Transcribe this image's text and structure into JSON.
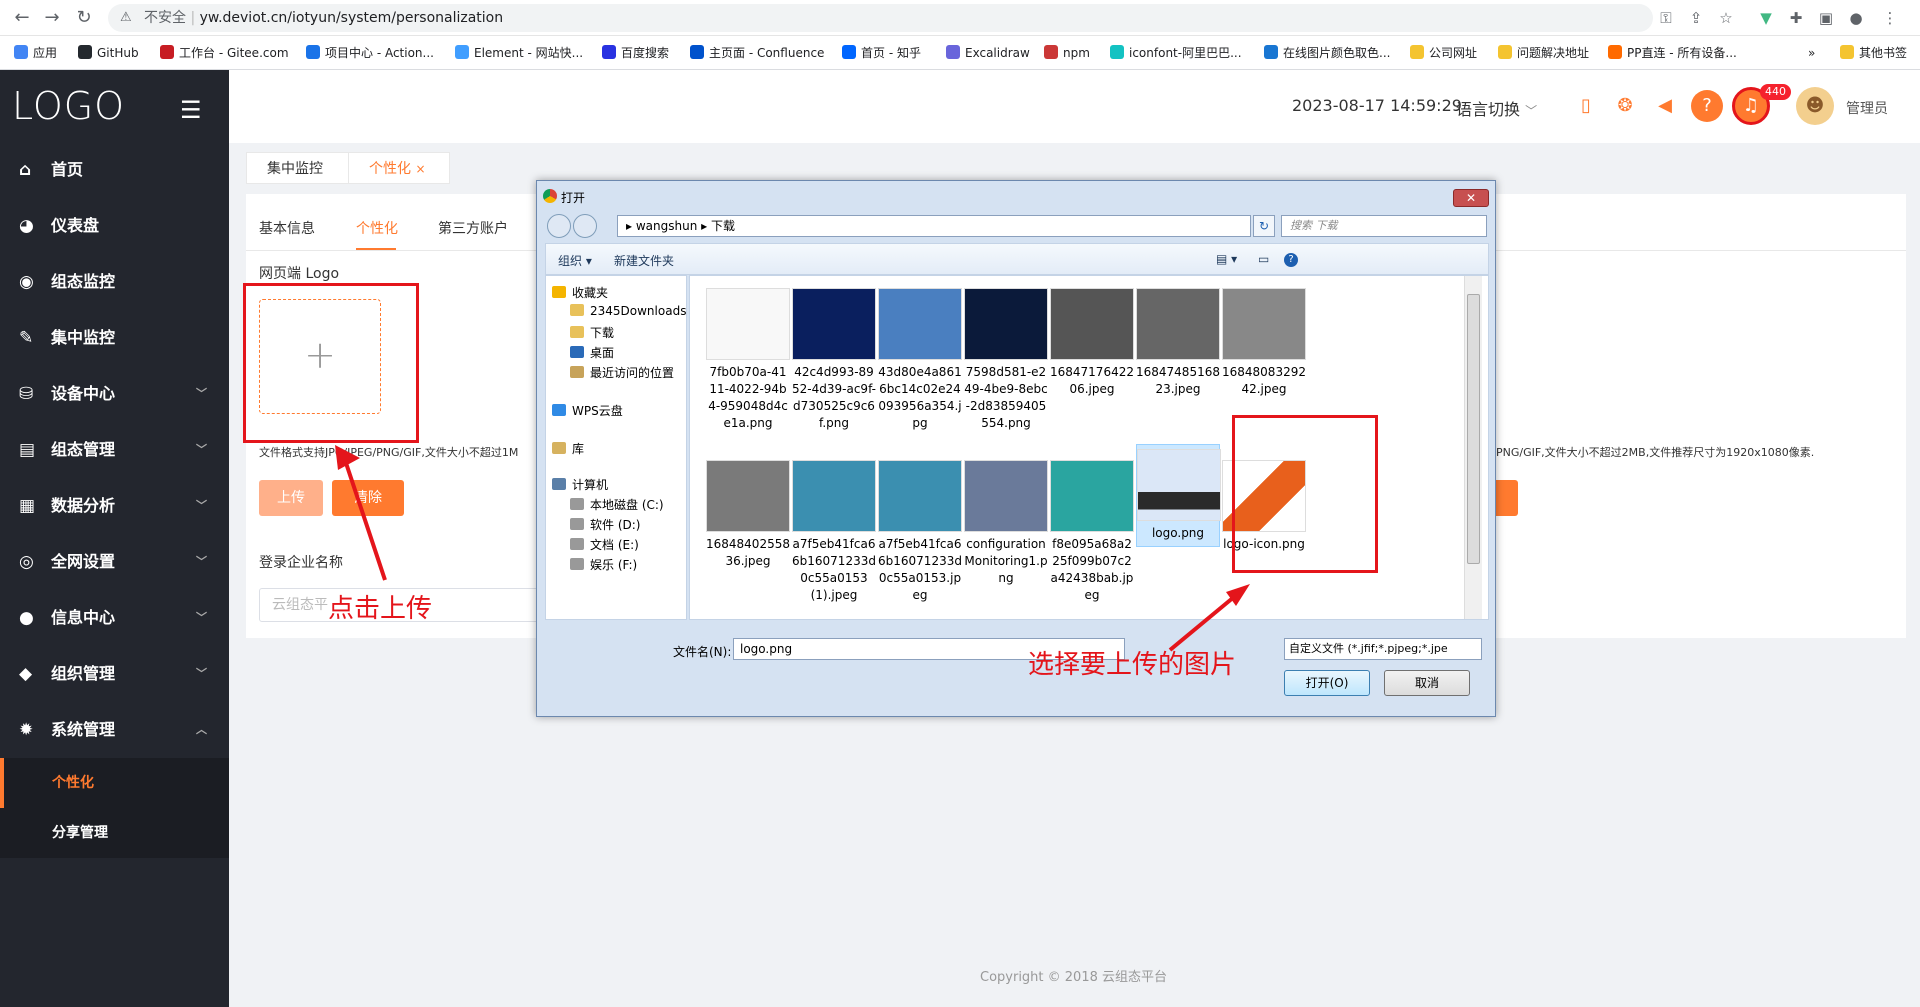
{
  "browser": {
    "insecure_label": "不安全",
    "url": "yw.deviot.cn/iotyun/system/personalization"
  },
  "bookmarks": [
    {
      "label": "应用",
      "color": "#4285f4"
    },
    {
      "label": "GitHub",
      "color": "#24292e"
    },
    {
      "label": "工作台 - Gitee.com",
      "color": "#c71d23"
    },
    {
      "label": "项目中心 - Action...",
      "color": "#1a73e8"
    },
    {
      "label": "Element - 网站快...",
      "color": "#409eff"
    },
    {
      "label": "百度搜索",
      "color": "#2932e1"
    },
    {
      "label": "主页面 - Confluence",
      "color": "#0052cc"
    },
    {
      "label": "首页 - 知乎",
      "color": "#0066ff"
    },
    {
      "label": "Excalidraw",
      "color": "#6965db"
    },
    {
      "label": "npm",
      "color": "#cb3837"
    },
    {
      "label": "iconfont-阿里巴巴...",
      "color": "#13c2c2"
    },
    {
      "label": "在线图片颜色取色...",
      "color": "#1976d2"
    },
    {
      "label": "公司网址",
      "color": "#f4c430"
    },
    {
      "label": "问题解决地址",
      "color": "#f4c430"
    },
    {
      "label": "PP直连 - 所有设备...",
      "color": "#ff6a00"
    },
    {
      "label": "其他书签",
      "color": "#f4c430"
    }
  ],
  "sidebar": {
    "logo": "LOGO",
    "items": [
      {
        "label": "首页",
        "icon": "⌂",
        "arrow": ""
      },
      {
        "label": "仪表盘",
        "icon": "◕",
        "arrow": ""
      },
      {
        "label": "组态监控",
        "icon": "◉",
        "arrow": ""
      },
      {
        "label": "集中监控",
        "icon": "✎",
        "arrow": ""
      },
      {
        "label": "设备中心",
        "icon": "⛁",
        "arrow": "﹀"
      },
      {
        "label": "组态管理",
        "icon": "▤",
        "arrow": "﹀"
      },
      {
        "label": "数据分析",
        "icon": "▦",
        "arrow": "﹀"
      },
      {
        "label": "全网设置",
        "icon": "◎",
        "arrow": "﹀"
      },
      {
        "label": "信息中心",
        "icon": "●",
        "arrow": "﹀"
      },
      {
        "label": "组织管理",
        "icon": "◆",
        "arrow": "﹀"
      },
      {
        "label": "系统管理",
        "icon": "✹",
        "arrow": "︿"
      }
    ],
    "sub_items": [
      "个性化",
      "分享管理"
    ]
  },
  "header": {
    "datetime": "2023-08-17 14:59:29",
    "lang_switch": "语言切换",
    "badge_count": "440",
    "username": "管理员"
  },
  "tabs": [
    {
      "label": "集中监控"
    },
    {
      "label": "个性化",
      "close": "×"
    }
  ],
  "content": {
    "tabs": [
      "基本信息",
      "个性化",
      "第三方账户"
    ],
    "web_logo_label": "网页端 Logo",
    "upload_plus": "+",
    "format_hint": "文件格式支持JPG/JPEG/PNG/GIF,文件大小不超过1M",
    "format_hint_right": "PNG/GIF,文件大小不超过2MB,文件推荐尺寸为1920x1080像素.",
    "upload_btn": "上传",
    "clear_btn": "清除",
    "company_label": "登录企业名称",
    "company_placeholder": "云组态平"
  },
  "footer": {
    "copyright": "Copyright © 2018 云组态平台"
  },
  "annotations": {
    "click_upload": "点击上传",
    "select_image": "选择要上传的图片"
  },
  "dialog": {
    "title": "打开",
    "close": "✕",
    "path_user": "wangshun",
    "path_folder": "下载",
    "search_placeholder": "搜索 下载",
    "organize": "组织 ▾",
    "new_folder": "新建文件夹",
    "nav": [
      {
        "label": "收藏夹",
        "color": "#f4b400"
      },
      {
        "label": "2345Downloads",
        "color": "#e8c15a"
      },
      {
        "label": "下载",
        "color": "#e8c15a"
      },
      {
        "label": "桌面",
        "color": "#2a6ab8"
      },
      {
        "label": "最近访问的位置",
        "color": "#c7a35a"
      },
      {
        "label": "WPS云盘",
        "color": "#2f8ae5"
      },
      {
        "label": "库",
        "color": "#d6b25f"
      },
      {
        "label": "计算机",
        "color": "#5a7fa8"
      },
      {
        "label": "本地磁盘 (C:)",
        "color": "#999999"
      },
      {
        "label": "软件 (D:)",
        "color": "#999999"
      },
      {
        "label": "文档 (E:)",
        "color": "#999999"
      },
      {
        "label": "娱乐 (F:)",
        "color": "#999999"
      }
    ],
    "files": [
      {
        "name": "7fb0b70a-4111-4022-94b4-959048d4ce1a.png",
        "thumb": "#f8f8f8"
      },
      {
        "name": "42c4d993-8952-4d39-ac9f-d730525c9c6f.png",
        "thumb": "#0a1f5e"
      },
      {
        "name": "43d80e4a8616bc14c02e24093956a354.jpg",
        "thumb": "#4a7fc0"
      },
      {
        "name": "7598d581-e249-4be9-8ebc-2d83859405554.png",
        "thumb": "#0b1a3a"
      },
      {
        "name": "1684717642206.jpeg",
        "thumb": "#555555"
      },
      {
        "name": "1684748516823.jpeg",
        "thumb": "#666666"
      },
      {
        "name": "1684808329242.jpeg",
        "thumb": "#888888"
      },
      {
        "name": "1684840255836.jpeg",
        "thumb": "#7a7a7a"
      },
      {
        "name": "a7f5eb41fca66b16071233d0c55a0153 (1).jpeg",
        "thumb": "#3b8fb0"
      },
      {
        "name": "a7f5eb41fca66b16071233d0c55a0153.jpeg",
        "thumb": "#3b8fb0"
      },
      {
        "name": "configurationMonitoring1.png",
        "thumb": "#6a7a9a"
      },
      {
        "name": "f8e095a68a225f099b07c2a42438bab.jpeg",
        "thumb": "#2aa5a0"
      },
      {
        "name": "logo.png",
        "thumb": "#2a2a2a"
      },
      {
        "name": "logo-icon.png",
        "thumb": "#e8601c"
      }
    ],
    "filename_label": "文件名(N):",
    "filename_value": "logo.png",
    "filter": "自定义文件 (*.jfif;*.pjpeg;*.jpe",
    "open_btn": "打开(O)",
    "cancel_btn": "取消"
  }
}
